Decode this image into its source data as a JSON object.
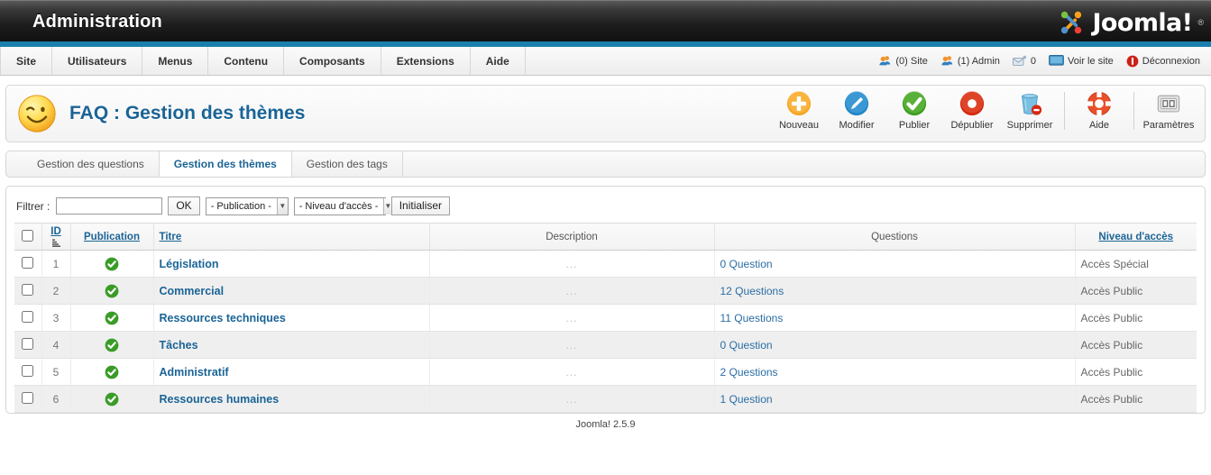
{
  "header": {
    "admin_title": "Administration",
    "brand": "Joomla!",
    "brand_reg": "®"
  },
  "menu": {
    "items": [
      {
        "label": "Site",
        "name": "site"
      },
      {
        "label": "Utilisateurs",
        "name": "utilisateurs"
      },
      {
        "label": "Menus",
        "name": "menus"
      },
      {
        "label": "Contenu",
        "name": "contenu"
      },
      {
        "label": "Composants",
        "name": "composants"
      },
      {
        "label": "Extensions",
        "name": "extensions"
      },
      {
        "label": "Aide",
        "name": "aide"
      }
    ],
    "status": [
      {
        "label": "(0) Site",
        "icon": "users-icon",
        "name": "site-visitors"
      },
      {
        "label": "(1) Admin",
        "icon": "users-icon",
        "name": "admin-users"
      },
      {
        "label": "0",
        "icon": "message-icon",
        "name": "messages"
      },
      {
        "label": "Voir le site",
        "icon": "monitor-icon",
        "name": "preview-site"
      },
      {
        "label": "Déconnexion",
        "icon": "logout-icon",
        "name": "logout"
      }
    ]
  },
  "page": {
    "title": "FAQ : Gestion des thèmes",
    "title_icon": "smiley-wink-icon"
  },
  "toolbar": {
    "buttons": [
      {
        "label": "Nouveau",
        "icon": "plus-circle-icon",
        "name": "new"
      },
      {
        "label": "Modifier",
        "icon": "pencil-circle-icon",
        "name": "edit"
      },
      {
        "label": "Publier",
        "icon": "check-circle-icon",
        "name": "publish"
      },
      {
        "label": "Dépublier",
        "icon": "minus-circle-icon",
        "name": "unpublish"
      },
      {
        "label": "Supprimer",
        "icon": "trash-icon",
        "name": "delete"
      },
      {
        "label": "Aide",
        "icon": "lifering-icon",
        "name": "help"
      },
      {
        "label": "Paramètres",
        "icon": "options-icon",
        "name": "options"
      }
    ]
  },
  "tabs": [
    {
      "label": "Gestion des questions",
      "name": "questions",
      "active": false
    },
    {
      "label": "Gestion des thèmes",
      "name": "themes",
      "active": true
    },
    {
      "label": "Gestion des tags",
      "name": "tags",
      "active": false
    }
  ],
  "filter": {
    "label": "Filtrer :",
    "search_value": "",
    "search_placeholder": "",
    "ok_label": "OK",
    "publication_select": "- Publication -",
    "access_select": "- Niveau d'accès -",
    "reset_label": "Initialiser"
  },
  "table": {
    "columns": {
      "id": "ID",
      "publication": "Publication",
      "titre": "Titre",
      "description": "Description",
      "questions": "Questions",
      "acces": "Niveau d'accès"
    },
    "rows": [
      {
        "id": "1",
        "published": true,
        "titre": "Législation",
        "description": "...",
        "questions": "0 Question",
        "acces": "Accès Spécial"
      },
      {
        "id": "2",
        "published": true,
        "titre": "Commercial",
        "description": "...",
        "questions": "12 Questions",
        "acces": "Accès Public"
      },
      {
        "id": "3",
        "published": true,
        "titre": "Ressources techniques",
        "description": "...",
        "questions": "11 Questions",
        "acces": "Accès Public"
      },
      {
        "id": "4",
        "published": true,
        "titre": "Tâches",
        "description": "...",
        "questions": "0 Question",
        "acces": "Accès Public"
      },
      {
        "id": "5",
        "published": true,
        "titre": "Administratif",
        "description": "...",
        "questions": "2 Questions",
        "acces": "Accès Public"
      },
      {
        "id": "6",
        "published": true,
        "titre": "Ressources humaines",
        "description": "...",
        "questions": "1 Question",
        "acces": "Accès Public"
      }
    ]
  },
  "footer": {
    "version": "Joomla! 2.5.9"
  },
  "colors": {
    "accent_blue": "#1b7fae",
    "link_blue": "#1a6496",
    "publish_green": "#3a9c27",
    "orange": "#f0932b",
    "red": "#e03a1e"
  }
}
